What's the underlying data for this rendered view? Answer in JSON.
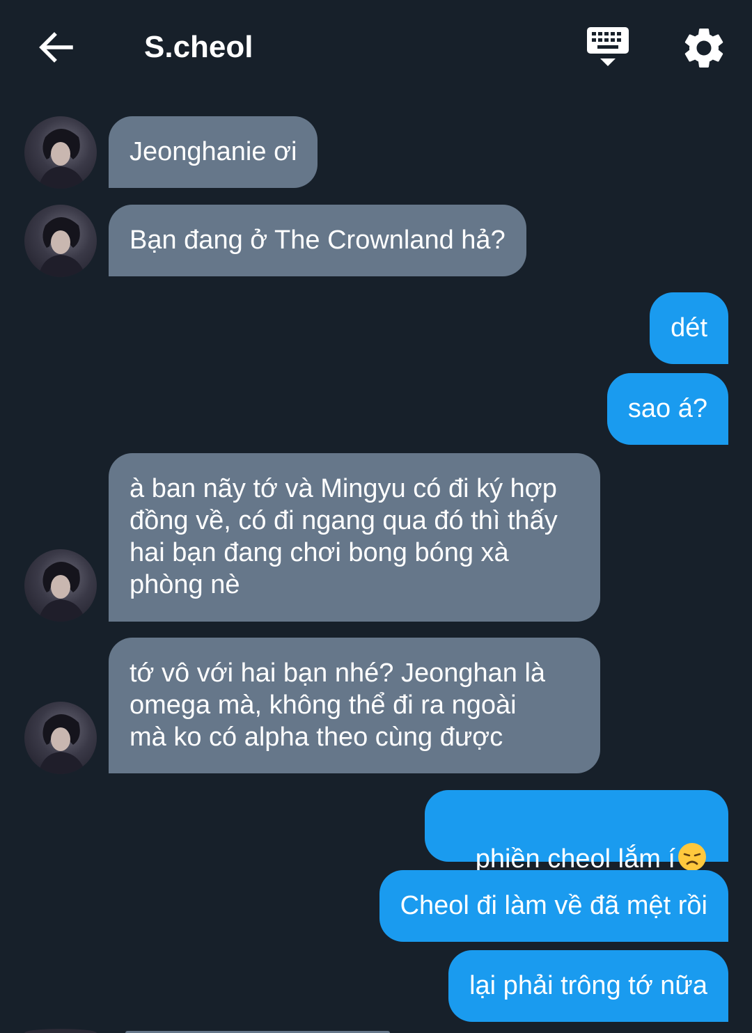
{
  "header": {
    "title": "S.cheol",
    "icons": {
      "back": "arrow-left-icon",
      "keyboard": "keyboard-hide-icon",
      "settings": "gear-icon"
    }
  },
  "colors": {
    "background": "#17202a",
    "incoming_bubble": "#66778a",
    "outgoing_bubble": "#1a9bef",
    "text": "#ffffff"
  },
  "messages": [
    {
      "side": "incoming",
      "text": "Jeonghanie ơi"
    },
    {
      "side": "incoming",
      "text": "Bạn đang ở The Crownland hả?"
    },
    {
      "side": "outgoing",
      "text": "dét"
    },
    {
      "side": "outgoing",
      "text": "sao á?"
    },
    {
      "side": "incoming",
      "text": "à ban nãy tớ và Mingyu có đi ký hợp\nđồng về, có đi ngang qua đó thì thấy\nhai bạn đang chơi bong bóng xà\nphòng nè"
    },
    {
      "side": "incoming",
      "text": "tớ vô với hai bạn nhé? Jeonghan là\nomega mà, không thể đi ra ngoài\nmà ko có alpha theo cùng được"
    },
    {
      "side": "outgoing",
      "text": "phiền cheol lắm í",
      "emoji": "disappointed-face-emoji"
    },
    {
      "side": "outgoing",
      "text": "Cheol đi làm về đã mệt rồi"
    },
    {
      "side": "outgoing",
      "text": "lại phải trông tớ nữa"
    }
  ]
}
